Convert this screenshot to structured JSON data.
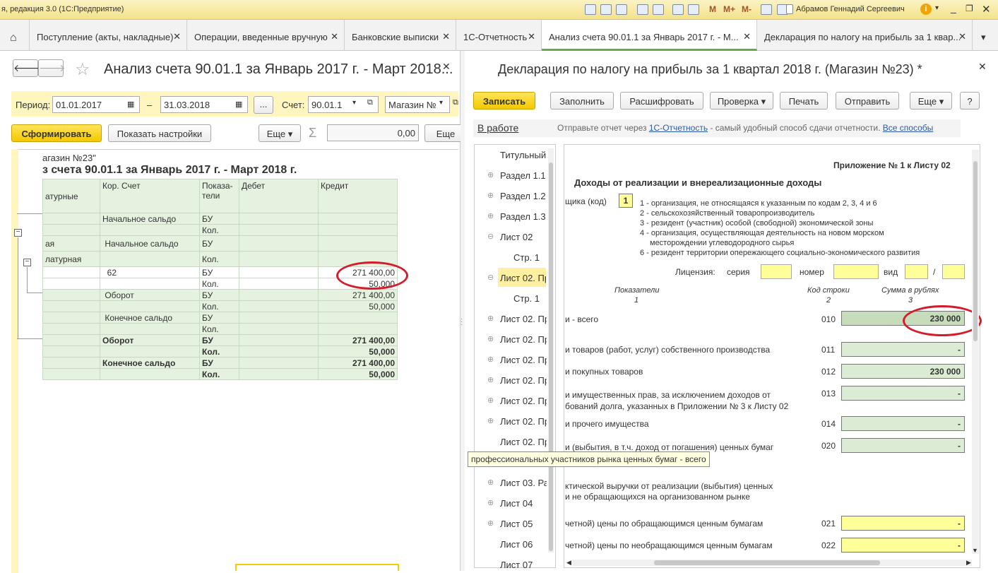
{
  "app": {
    "title": "я, редакция 3.0  (1С:Предприятие)",
    "user": "Абрамов Геннадий Сергеевич",
    "toolbar_m": [
      "M",
      "M+",
      "M-"
    ]
  },
  "tabs": [
    {
      "label": "Поступление (акты, накладные)"
    },
    {
      "label": "Операции, введенные вручную"
    },
    {
      "label": "Банковские выписки"
    },
    {
      "label": "1С-Отчетность"
    },
    {
      "label": "Анализ счета 90.01.1 за Январь 2017 г. - М..."
    },
    {
      "label": "Декларация по налогу на прибыль за 1 квар..."
    }
  ],
  "left": {
    "title": "Анализ счета 90.01.1 за Январь 2017 г. - Март 2018...",
    "period_label": "Период:",
    "date_from": "01.01.2017",
    "dash": "–",
    "date_to": "31.03.2018",
    "dots": "...",
    "account_label": "Счет:",
    "account": "90.01.1",
    "org": "Магазин №",
    "generate": "Сформировать",
    "show_settings": "Показать настройки",
    "more": "Еще",
    "sigma": "Σ",
    "sum": "0,00",
    "more2": "Еще",
    "report_org": "агазин №23\"",
    "report_title": "з счета 90.01.1 за Январь 2017 г. - Март 2018 г.",
    "headers": {
      "c0": "атурные",
      "c1": "Кор. Счет",
      "c2": "Показа-\nтели",
      "c3": "Дебет",
      "c4": "Кредит"
    },
    "rows": [
      {
        "c0": "",
        "c1": "Начальное сальдо",
        "c2": "БУ",
        "c4": ""
      },
      {
        "c0": "",
        "c1": "",
        "c2": "Кол.",
        "c4": ""
      },
      {
        "c0": "ая",
        "c1": " Начальное сальдо",
        "c2": "БУ",
        "c4": ""
      },
      {
        "c0": "латурная",
        "c1": "",
        "c2": "Кол.",
        "c4": ""
      },
      {
        "c0": "",
        "c1": "  62",
        "c2": "БУ",
        "c4": "271 400,00"
      },
      {
        "c0": "",
        "c1": "",
        "c2": "Кол.",
        "c4": "50,000"
      },
      {
        "c0": "",
        "c1": " Оборот",
        "c2": "БУ",
        "c4": "271 400,00"
      },
      {
        "c0": "",
        "c1": "",
        "c2": "Кол.",
        "c4": "50,000"
      },
      {
        "c0": "",
        "c1": " Конечное сальдо",
        "c2": "БУ",
        "c4": ""
      },
      {
        "c0": "",
        "c1": "",
        "c2": "Кол.",
        "c4": ""
      },
      {
        "c0": "",
        "c1": "Оборот",
        "c2": "БУ",
        "c4": "271 400,00"
      },
      {
        "c0": "",
        "c1": "",
        "c2": "Кол.",
        "c4": "50,000"
      },
      {
        "c0": "",
        "c1": "Конечное сальдо",
        "c2": "БУ",
        "c4": "271 400,00"
      },
      {
        "c0": "",
        "c1": "",
        "c2": "Кол.",
        "c4": "50,000"
      }
    ]
  },
  "right": {
    "title": "Декларация по налогу на прибыль за 1 квартал 2018 г. (Магазин №23) *",
    "buttons": {
      "save": "Записать",
      "fill": "Заполнить",
      "decode": "Расшифровать",
      "check": "Проверка",
      "print": "Печать",
      "send": "Отправить",
      "more": "Еще",
      "help": "?"
    },
    "status": "В работе",
    "info": "Отправьте отчет через",
    "info_link": "1С-Отчетность",
    "info_tail": " - самый удобный способ сдачи отчетности.",
    "all_ways": "Все способы",
    "tree": [
      "Титульный",
      "Раздел 1.1",
      "Раздел 1.2",
      "Раздел 1.3",
      "Лист 02",
      "Стр. 1",
      "Лист 02. Пр",
      "Стр. 1",
      "Лист 02. Пр",
      "Лист 02. Пр",
      "Лист 02. Пр",
      "Лист 02. Пр",
      "Лист 02. Пр",
      "Лист 02. Пр",
      "Лист 02. Пр",
      "Лист 03. Ра",
      "Лист 04",
      "Лист 05",
      "Лист 06",
      "Лист 07"
    ],
    "form": {
      "appendix": "Приложение № 1 к Листу 02",
      "heading": "Доходы от реализации и внереализационные доходы",
      "payer_label": "щика (код)",
      "payer_code": "1",
      "codes": [
        "1 - организация, не относящаяся к указанным по кодам 2, 3, 4 и 6",
        "2 - сельскохозяйственный товаропроизводитель",
        "3 - резидент (участник) особой (свободной) экономической зоны",
        "4 - организация, осуществляющая деятельность на новом морском",
        "месторождении углеводородного сырья",
        "6 - резидент территории опережающего социально-экономического развития"
      ],
      "license": "Лицензия:",
      "series": "серия",
      "number": "номер",
      "kind": "вид",
      "slash": "/",
      "col_headers": [
        "Показатели",
        "Код строки",
        "Сумма в рублях"
      ],
      "col_nums": [
        "1",
        "2",
        "3"
      ],
      "lines": [
        {
          "text": "и - всего",
          "code": "010",
          "value": "230 000"
        },
        {
          "text": "и товаров (работ, услуг) собственного производства",
          "code": "011",
          "value": "-"
        },
        {
          "text": "и покупных товаров",
          "code": "012",
          "value": "230 000"
        },
        {
          "text": "и имущественных прав, за исключением доходов от",
          "text2": "бований долга, указанных в Приложении № 3 к Листу 02",
          "code": "013",
          "value": "-"
        },
        {
          "text": "и прочего имущества",
          "code": "014",
          "value": "-"
        },
        {
          "text": "и (выбытия, в т.ч. доход от погашения) ценных бумаг",
          "code": "020",
          "value": "-"
        },
        {
          "text": "ктической выручки от реализации (выбытия) ценных",
          "text2": "и не обращающихся на организованном рынке"
        },
        {
          "text": "четной) цены по обращающимся ценным бумагам",
          "code": "021",
          "value": "-"
        },
        {
          "text": "четной) цены по необращающимся ценным бумагам",
          "code": "022",
          "value": "-"
        }
      ],
      "tooltip": "профессиональных участников рынка ценных бумаг - всего"
    }
  }
}
